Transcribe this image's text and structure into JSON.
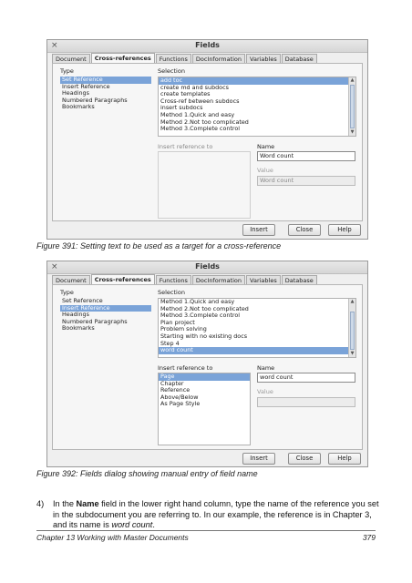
{
  "dialog1": {
    "title": "Fields",
    "close_glyph": "×",
    "tabs": [
      "Document",
      "Cross-references",
      "Functions",
      "DocInformation",
      "Variables",
      "Database"
    ],
    "type_label": "Type",
    "type_items": [
      "Set Reference",
      "Insert Reference",
      "Headings",
      "Numbered Paragraphs",
      "Bookmarks"
    ],
    "type_selected": 0,
    "selection_label": "Selection",
    "selection_items": [
      "add toc",
      "create md and subdocs",
      "create templates",
      "Cross-ref between subdocs",
      "insert subdocs",
      "Method 1.Quick and easy",
      "Method 2.Not too complicated",
      "Method 3.Complete control"
    ],
    "selection_selected": 0,
    "insert_ref_label": "Insert reference to",
    "name_label": "Name",
    "name_value": "Word count",
    "value_label": "Value",
    "value_value": "Word count",
    "buttons": [
      "Insert",
      "Close",
      "Help"
    ]
  },
  "caption1": "Figure 391: Setting text to be used as a target for a cross-reference",
  "dialog2": {
    "title": "Fields",
    "tabs": [
      "Document",
      "Cross-references",
      "Functions",
      "DocInformation",
      "Variables",
      "Database"
    ],
    "type_label": "Type",
    "type_items": [
      "Set Reference",
      "Insert Reference",
      "Headings",
      "Numbered Paragraphs",
      "Bookmarks"
    ],
    "type_selected": 1,
    "selection_label": "Selection",
    "selection_items": [
      "Method 1.Quick and easy",
      "Method 2.Not too complicated",
      "Method 3.Complete control",
      "Plan project",
      "Problem solving",
      "Starting with no existing docs",
      "Step 4",
      "word count"
    ],
    "selection_selected": 7,
    "insert_ref_label": "Insert reference to",
    "insert_ref_items": [
      "Page",
      "Chapter",
      "Reference",
      "Above/Below",
      "As Page Style"
    ],
    "insert_ref_selected": 0,
    "name_label": "Name",
    "name_value": "word count",
    "value_label": "Value",
    "value_value": "",
    "buttons": [
      "Insert",
      "Close",
      "Help"
    ]
  },
  "caption2": "Figure 392: Fields dialog showing manual entry of field name",
  "step": {
    "number": "4)",
    "text_before": "In the ",
    "bold_word": "Name",
    "text_middle": " field in the lower right hand column, type the name of the reference you set in the subdocument you are referring to. In our example, the reference is in Chapter 3, and its name is ",
    "italic_word": "word count",
    "text_end": "."
  },
  "footer": {
    "left": "Chapter 13  Working with Master Documents",
    "right": "379"
  },
  "colors": {
    "selection": "#7aa3d8",
    "dialog_bg": "#efefef"
  }
}
